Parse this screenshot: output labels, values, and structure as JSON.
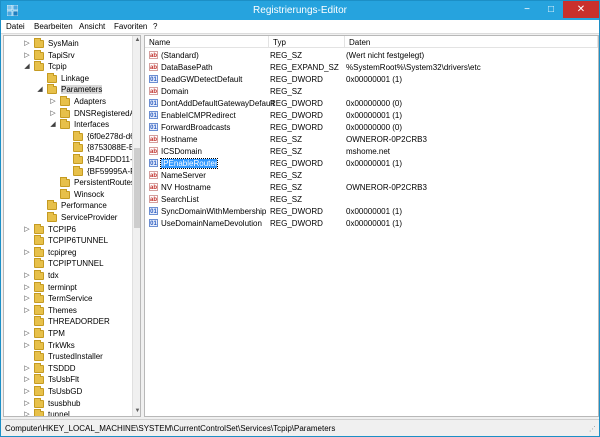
{
  "window": {
    "title": "Registrierungs-Editor",
    "accent_color": "#26a3de",
    "close_color": "#c9302c"
  },
  "menubar": {
    "items": [
      "Datei",
      "Bearbeiten",
      "Ansicht",
      "Favoriten",
      "?"
    ]
  },
  "tree": {
    "nodes": [
      {
        "label": "SysMain",
        "expander": "▷"
      },
      {
        "label": "TapiSrv",
        "expander": "▷"
      },
      {
        "label": "Tcpip",
        "expander": "◢"
      },
      {
        "label": "Linkage",
        "expander": ""
      },
      {
        "label": "Parameters",
        "expander": "◢"
      },
      {
        "label": "Adapters",
        "expander": "▷"
      },
      {
        "label": "DNSRegisteredAc",
        "expander": "▷"
      },
      {
        "label": "Interfaces",
        "expander": "◢"
      },
      {
        "label": "{6f0e278d-d6f",
        "expander": ""
      },
      {
        "label": "{8753088E-B19",
        "expander": ""
      },
      {
        "label": "{B4DFDD11-C",
        "expander": ""
      },
      {
        "label": "{BF59995A-FA",
        "expander": ""
      },
      {
        "label": "PersistentRoutes",
        "expander": ""
      },
      {
        "label": "Winsock",
        "expander": ""
      },
      {
        "label": "Performance",
        "expander": ""
      },
      {
        "label": "ServiceProvider",
        "expander": ""
      },
      {
        "label": "TCPIP6",
        "expander": "▷"
      },
      {
        "label": "TCPIP6TUNNEL",
        "expander": ""
      },
      {
        "label": "tcpipreg",
        "expander": "▷"
      },
      {
        "label": "TCPIPTUNNEL",
        "expander": ""
      },
      {
        "label": "tdx",
        "expander": "▷"
      },
      {
        "label": "terminpt",
        "expander": "▷"
      },
      {
        "label": "TermService",
        "expander": "▷"
      },
      {
        "label": "Themes",
        "expander": "▷"
      },
      {
        "label": "THREADORDER",
        "expander": ""
      },
      {
        "label": "TPM",
        "expander": "▷"
      },
      {
        "label": "TrkWks",
        "expander": "▷"
      },
      {
        "label": "TrustedInstaller",
        "expander": ""
      },
      {
        "label": "TSDDD",
        "expander": "▷"
      },
      {
        "label": "TsUsbFlt",
        "expander": "▷"
      },
      {
        "label": "TsUsbGD",
        "expander": "▷"
      },
      {
        "label": "tsusbhub",
        "expander": "▷"
      },
      {
        "label": "tunnel",
        "expander": "▷"
      }
    ]
  },
  "list": {
    "headers": {
      "name": "Name",
      "type": "Typ",
      "data": "Daten"
    },
    "rows": [
      {
        "icon": "ab",
        "name": "(Standard)",
        "type": "REG_SZ",
        "data": "(Wert nicht festgelegt)"
      },
      {
        "icon": "ab",
        "name": "DataBasePath",
        "type": "REG_EXPAND_SZ",
        "data": "%SystemRoot%\\System32\\drivers\\etc"
      },
      {
        "icon": "dw",
        "name": "DeadGWDetectDefault",
        "type": "REG_DWORD",
        "data": "0x00000001 (1)"
      },
      {
        "icon": "ab",
        "name": "Domain",
        "type": "REG_SZ",
        "data": ""
      },
      {
        "icon": "dw",
        "name": "DontAddDefaultGatewayDefault",
        "type": "REG_DWORD",
        "data": "0x00000000 (0)"
      },
      {
        "icon": "dw",
        "name": "EnableICMPRedirect",
        "type": "REG_DWORD",
        "data": "0x00000001 (1)"
      },
      {
        "icon": "dw",
        "name": "ForwardBroadcasts",
        "type": "REG_DWORD",
        "data": "0x00000000 (0)"
      },
      {
        "icon": "ab",
        "name": "Hostname",
        "type": "REG_SZ",
        "data": "OWNEROR-0P2CRB3"
      },
      {
        "icon": "ab",
        "name": "ICSDomain",
        "type": "REG_SZ",
        "data": "mshome.net"
      },
      {
        "icon": "dw",
        "name": "IPEnableRouter",
        "type": "REG_DWORD",
        "data": "0x00000001 (1)"
      },
      {
        "icon": "ab",
        "name": "NameServer",
        "type": "REG_SZ",
        "data": ""
      },
      {
        "icon": "ab",
        "name": "NV Hostname",
        "type": "REG_SZ",
        "data": "OWNEROR-0P2CRB3"
      },
      {
        "icon": "ab",
        "name": "SearchList",
        "type": "REG_SZ",
        "data": ""
      },
      {
        "icon": "dw",
        "name": "SyncDomainWithMembership",
        "type": "REG_DWORD",
        "data": "0x00000001 (1)"
      },
      {
        "icon": "dw",
        "name": "UseDomainNameDevolution",
        "type": "REG_DWORD",
        "data": "0x00000001 (1)"
      }
    ]
  },
  "statusbar": {
    "path": "Computer\\HKEY_LOCAL_MACHINE\\SYSTEM\\CurrentControlSet\\Services\\Tcpip\\Parameters"
  }
}
